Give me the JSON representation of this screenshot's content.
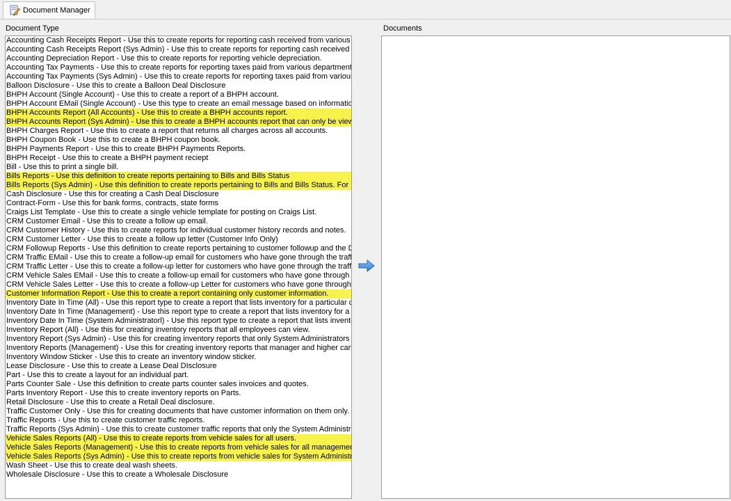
{
  "tab": {
    "label": "Document Manager"
  },
  "document_type_label": "Document Type",
  "documents_label": "Documents",
  "highlight_color": "#f8f24c",
  "document_types": [
    {
      "text": "Accounting Cash Receipts Report - Use this to create reports for reporting cash received from various departments.",
      "highlighted": false
    },
    {
      "text": "Accounting Cash Receipts Report (Sys Admin) - Use this to create reports for reporting cash received from various departments.",
      "highlighted": false
    },
    {
      "text": "Accounting Depreciation Report - Use this to create reports for reporting vehicle depreciation.",
      "highlighted": false
    },
    {
      "text": "Accounting Tax Payments - Use this to create reports for reporting taxes paid from various departments.",
      "highlighted": false
    },
    {
      "text": "Accounting Tax Payments (Sys Admin) - Use this to create reports for reporting taxes paid from various departments.",
      "highlighted": false
    },
    {
      "text": "Balloon Disclosure - Use this to create a Balloon Deal Disclosure",
      "highlighted": false
    },
    {
      "text": "BHPH Account (Single Account) - Use this to create a report of a BHPH account.",
      "highlighted": false
    },
    {
      "text": "BHPH Account EMail (Single Account) - Use this type to create an email message based on information in a BHPH account.",
      "highlighted": false
    },
    {
      "text": "BHPH Accounts Report (All Accounts) - Use this to create a BHPH accounts report.",
      "highlighted": true
    },
    {
      "text": "BHPH Accounts Report (Sys Admin) - Use this to create a BHPH accounts report that can only be viewed by System Administrators.",
      "highlighted": true
    },
    {
      "text": "BHPH Charges Report - Use this to create a report that returns all charges across all accounts.",
      "highlighted": false
    },
    {
      "text": "BHPH Coupon Book - Use this to create a BHPH coupon book.",
      "highlighted": false
    },
    {
      "text": "BHPH Payments Report - Use this to create BHPH Payments Reports.",
      "highlighted": false
    },
    {
      "text": "BHPH Receipt - Use this to create a BHPH payment reciept",
      "highlighted": false
    },
    {
      "text": "Bill - Use this to print a single bill.",
      "highlighted": false
    },
    {
      "text": "Bills Reports - Use this definition to create reports pertaining to Bills and Bills Status",
      "highlighted": true
    },
    {
      "text": "Bills Reports (Sys Admin) - Use this definition to create reports pertaining to Bills and Bills Status. For System Administrators only.",
      "highlighted": true
    },
    {
      "text": "Cash Disclosure - Use this for creating a Cash Deal Disclosure",
      "highlighted": false
    },
    {
      "text": "Contract-Form - Use this for bank forms, contracts, state forms",
      "highlighted": false
    },
    {
      "text": "Craigs List Template - Use this to create a single vehicle template for posting on Craigs List.",
      "highlighted": false
    },
    {
      "text": "CRM Customer Email - Use this to create a follow up email.",
      "highlighted": false
    },
    {
      "text": "CRM Customer History - Use this to create reports for individual customer history records and notes.",
      "highlighted": false
    },
    {
      "text": "CRM Customer Letter - Use this to create a follow up letter (Customer Info Only)",
      "highlighted": false
    },
    {
      "text": "CRM Followup Reports - Use this definition to create reports pertaining to customer followup and the Daily Planner.",
      "highlighted": false
    },
    {
      "text": "CRM Traffic EMail - Use this to create a follow-up email for customers who have gone through the traffic/customer log.",
      "highlighted": false
    },
    {
      "text": "CRM Traffic Letter - Use this to create a follow-up letter for customers who have gone through the traffic/customer log.",
      "highlighted": false
    },
    {
      "text": "CRM Vehicle Sales EMail - Use this to create a follow-up email for customers who have gone through the sales process.",
      "highlighted": false
    },
    {
      "text": "CRM Vehicle Sales Letter - Use this to create a follow-up Letter for customers who have gone through the sales process.",
      "highlighted": false
    },
    {
      "text": "Customer Information Report - Use this to create a report containing only customer information.",
      "highlighted": true
    },
    {
      "text": "Inventory Date In Time (All) - Use this report type to create a report that lists inventory for a particular date.",
      "highlighted": false
    },
    {
      "text": "Inventory Date In Time (Management) - Use this report type to create a report that lists inventory for a particular date.",
      "highlighted": false
    },
    {
      "text": "Inventory Date In Time (System Administratorl) - Use this report type to create a report that lists inventory for a particular date.",
      "highlighted": false
    },
    {
      "text": "Inventory Report (All) - Use this for creating inventory reports that all employees can view.",
      "highlighted": false
    },
    {
      "text": "Inventory Report (Sys Admin) - Use this for creating inventory reports that only System Administrators can view.",
      "highlighted": false
    },
    {
      "text": "Inventory Reports (Management) - Use this for creating inventory reports that manager and higher can view.",
      "highlighted": false
    },
    {
      "text": "Inventory Window Sticker - Use this to create an inventory window sticker.",
      "highlighted": false
    },
    {
      "text": "Lease Disclosure - Use this to create a Lease Deal DIsclosure",
      "highlighted": false
    },
    {
      "text": "Part - Use this to create a layout for an individual part.",
      "highlighted": false
    },
    {
      "text": "Parts Counter Sale - Use this definition to create parts counter sales invoices and quotes.",
      "highlighted": false
    },
    {
      "text": "Parts Inventory Report - Use this to create inventory reports on Parts.",
      "highlighted": false
    },
    {
      "text": "Retail Disclosure - Use this to create a Retail Deal disclosure.",
      "highlighted": false
    },
    {
      "text": "Traffic Customer Only - Use this for creating documents that have customer information on them only.",
      "highlighted": false
    },
    {
      "text": "Traffic Reports - Use this to create customer traffic reports.",
      "highlighted": false
    },
    {
      "text": "Traffic Reports (Sys Admin) - Use this to create customer traffic reports that only the System Administrator can view.",
      "highlighted": false
    },
    {
      "text": "Vehicle Sales Reports (All) - Use this to create reports from vehicle sales for all users.",
      "highlighted": true
    },
    {
      "text": "Vehicle Sales Reports (Management) - Use this to create reports from vehicle sales for all management.",
      "highlighted": true
    },
    {
      "text": "Vehicle Sales Reports (Sys Admin) - Use this to create reports from vehicle sales for System Administrators only.",
      "highlighted": true
    },
    {
      "text": "Wash Sheet - Use this to create deal wash sheets.",
      "highlighted": false
    },
    {
      "text": "Wholesale Disclosure - Use this to create a Wholesale Disclosure",
      "highlighted": false
    }
  ]
}
